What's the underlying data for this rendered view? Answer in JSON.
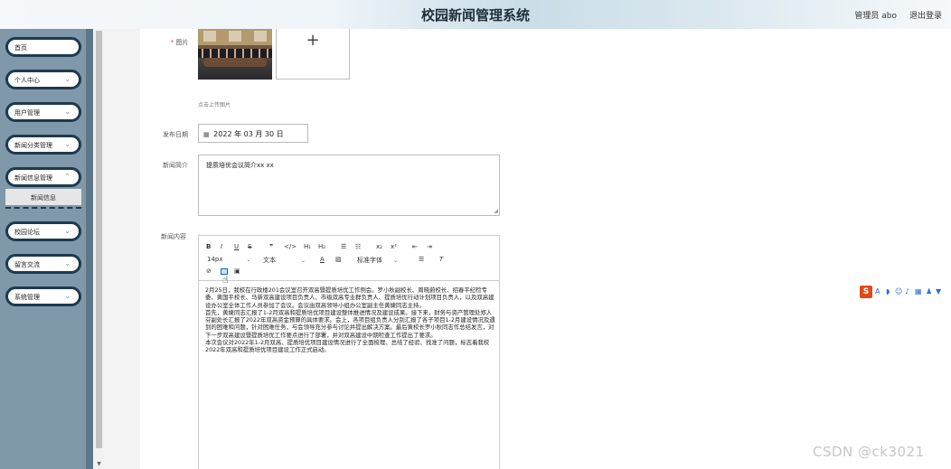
{
  "header": {
    "title": "校园新闻管理系统",
    "user": "管理员 abo",
    "logout": "退出登录"
  },
  "sidebar": {
    "items": [
      {
        "label": "首页"
      },
      {
        "label": "个人中心"
      },
      {
        "label": "用户管理"
      },
      {
        "label": "新闻分类管理"
      },
      {
        "label": "新闻信息管理"
      },
      {
        "label": "校园论坛"
      },
      {
        "label": "留言交流"
      },
      {
        "label": "系统管理"
      }
    ],
    "submenu": {
      "label": "新闻信息"
    }
  },
  "form": {
    "image_label": "图片",
    "upload_plus": "+",
    "upload_hint": "点击上传图片",
    "date_label": "发布日期",
    "date_value": "2022 年 03 月 30 日",
    "summary_label": "新闻简介",
    "summary_value": "提质培优会议简介xx xx",
    "content_label": "新闻内容"
  },
  "editor": {
    "toolbar_row1": [
      "B",
      "I",
      "U",
      "S",
      "❞",
      "</>",
      "H₁",
      "H₂",
      "☰",
      "☷",
      "x₂",
      "x²",
      "⇤",
      "⇥"
    ],
    "size_value": "14px",
    "heading_value": "文本",
    "font_value": "标准字体",
    "paragraphs": [
      "2月25日，我校在行政楼201会议室召开双高暨提质培优工作例会。罗小秋副校长、周晓蔚校长、招春平纪检专委、黄国平校长、马新双高建设项目负责人、市级双高专业群负责人、提质培优行动计划项目负责人，以及双高建设办公室全体工作人员参加了会议。会议由双高领导小组办公室副主任黄婕同志主持。",
      "首先，黄婕同志汇报了1-2月双高和提质培优项目建设整体推进情况及建设成果。接下来，财务与资产管理处郑人芬副处长汇报了2022年双高资金预算的具体要求。会上，各项目组负责人分别汇报了各子项目1-2月建设情况及遇到的困难和问题，针对困难任务，与会领导充分参与讨论并提出解决方案。最后黄校长罗小秋同志作总结发言，对下一步双高建设暨提质培优工作要点进行了部署，并对双高建设中期检查工作提出了要求。",
      "本次会议对2022年1-2月双高、提质培优项目建设情况进行了全面梳理、总结了经验、找准了问题，标志着我校2022年双高和提质培优项目建设工作正式启动。"
    ]
  },
  "watermark": "CSDN @ck3021",
  "colors": {
    "sidebar": "#7f98aa",
    "menu_border": "#1e3a4c",
    "required": "#e45"
  }
}
